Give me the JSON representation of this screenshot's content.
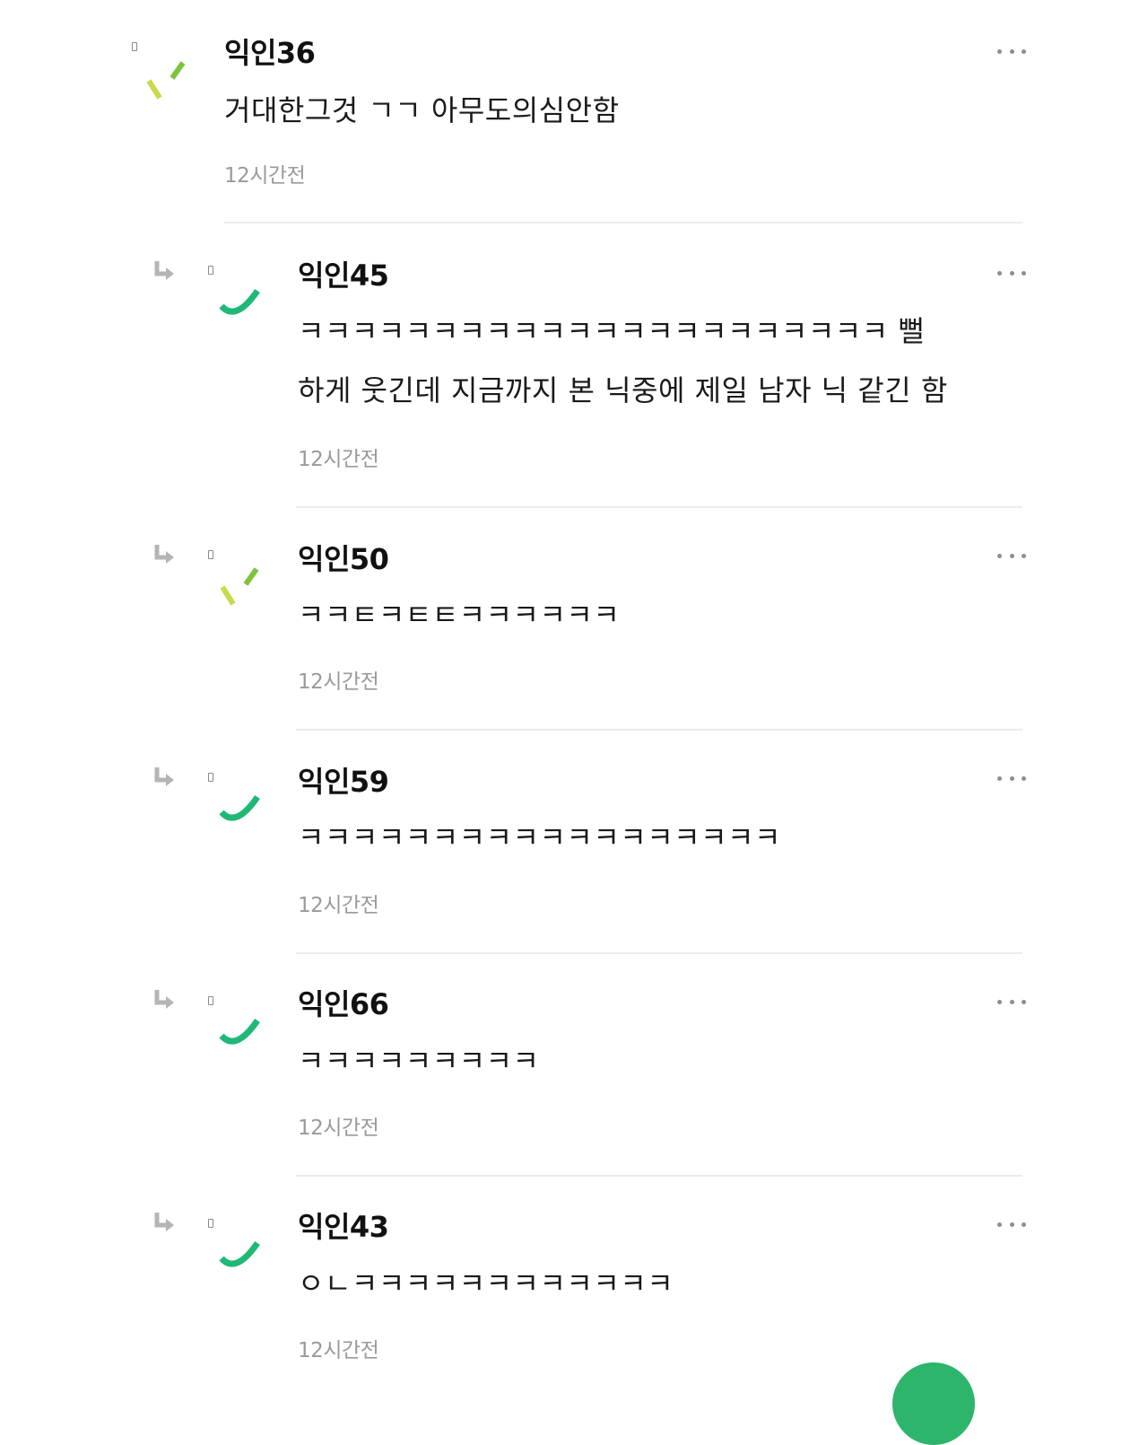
{
  "comments": [
    {
      "nickname": "익인36",
      "lines": [
        "거대한그것 ㄱㄱ 아무도의심안함"
      ],
      "time": "12시간전",
      "avatar": "yellow-green-dashes-avatar",
      "is_reply": false
    },
    {
      "nickname": "익인45",
      "lines": [
        "ㅋㅋㅋㅋㅋㅋㅋㅋㅋㅋㅋㅋㅋㅋㅋㅋㅋㅋㅋㅋㅋㅋ 뻘",
        "하게 웃긴데 지금까지 본 닉중에 제일 남자 닉 같긴 함"
      ],
      "time": "12시간전",
      "avatar": "green-arc-avatar",
      "is_reply": true
    },
    {
      "nickname": "익인50",
      "lines": [
        "ㅋㅋㅌㅋㅌㅌㅋㅋㅋㅋㅋㅋ"
      ],
      "time": "12시간전",
      "avatar": "yellow-green-dashes-avatar",
      "is_reply": true
    },
    {
      "nickname": "익인59",
      "lines": [
        "ㅋㅋㅋㅋㅋㅋㅋㅋㅋㅋㅋㅋㅋㅋㅋㅋㅋㅋ"
      ],
      "time": "12시간전",
      "avatar": "green-arc-avatar",
      "is_reply": true
    },
    {
      "nickname": "익인66",
      "lines": [
        "ㅋㅋㅋㅋㅋㅋㅋㅋㅋ"
      ],
      "time": "12시간전",
      "avatar": "green-arc-avatar",
      "is_reply": true
    },
    {
      "nickname": "익인43",
      "lines": [
        "ㅇㄴㅋㅋㅋㅋㅋㅋㅋㅋㅋㅋㅋㅋ"
      ],
      "time": "12시간전",
      "avatar": "green-arc-avatar",
      "is_reply": true
    }
  ],
  "icons": {
    "more": "more-horizontal-icon",
    "reply": "reply-arrow-icon",
    "fab": "write-comment-fab"
  },
  "colors": {
    "avatar_green": "#20b877",
    "avatar_yellow": "#c8d94a",
    "avatar_lime": "#7dc43c",
    "reply_arrow": "#b5b5b5",
    "time_text": "#9a9a9a",
    "divider": "#ececec",
    "fab": "#2db56b"
  }
}
